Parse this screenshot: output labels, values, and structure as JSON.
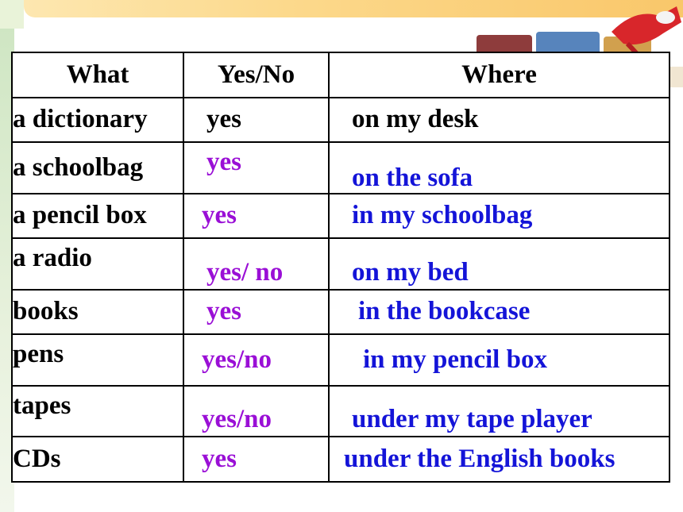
{
  "headers": {
    "what": "What",
    "yesno": "Yes/No",
    "where": "Where"
  },
  "rows": [
    {
      "what": "a dictionary",
      "yesno": "yes",
      "where": "on my desk"
    },
    {
      "what": "a schoolbag",
      "yesno": "yes",
      "where": "on the sofa"
    },
    {
      "what": "a pencil box",
      "yesno": "yes",
      "where": "in my schoolbag"
    },
    {
      "what": "a radio",
      "yesno": "yes/ no",
      "where": "on my bed"
    },
    {
      "what": "books",
      "yesno": "yes",
      "where": "in the bookcase"
    },
    {
      "what": "pens",
      "yesno": "yes/no",
      "where": "in my pencil box"
    },
    {
      "what": "tapes",
      "yesno": "yes/no",
      "where": "under my tape player"
    },
    {
      "what": "CDs",
      "yesno": "yes",
      "where": "under the English books"
    }
  ],
  "colors": {
    "answer_yesno": "#9a0fd6",
    "answer_where": "#1414d8",
    "given": "#000000"
  }
}
